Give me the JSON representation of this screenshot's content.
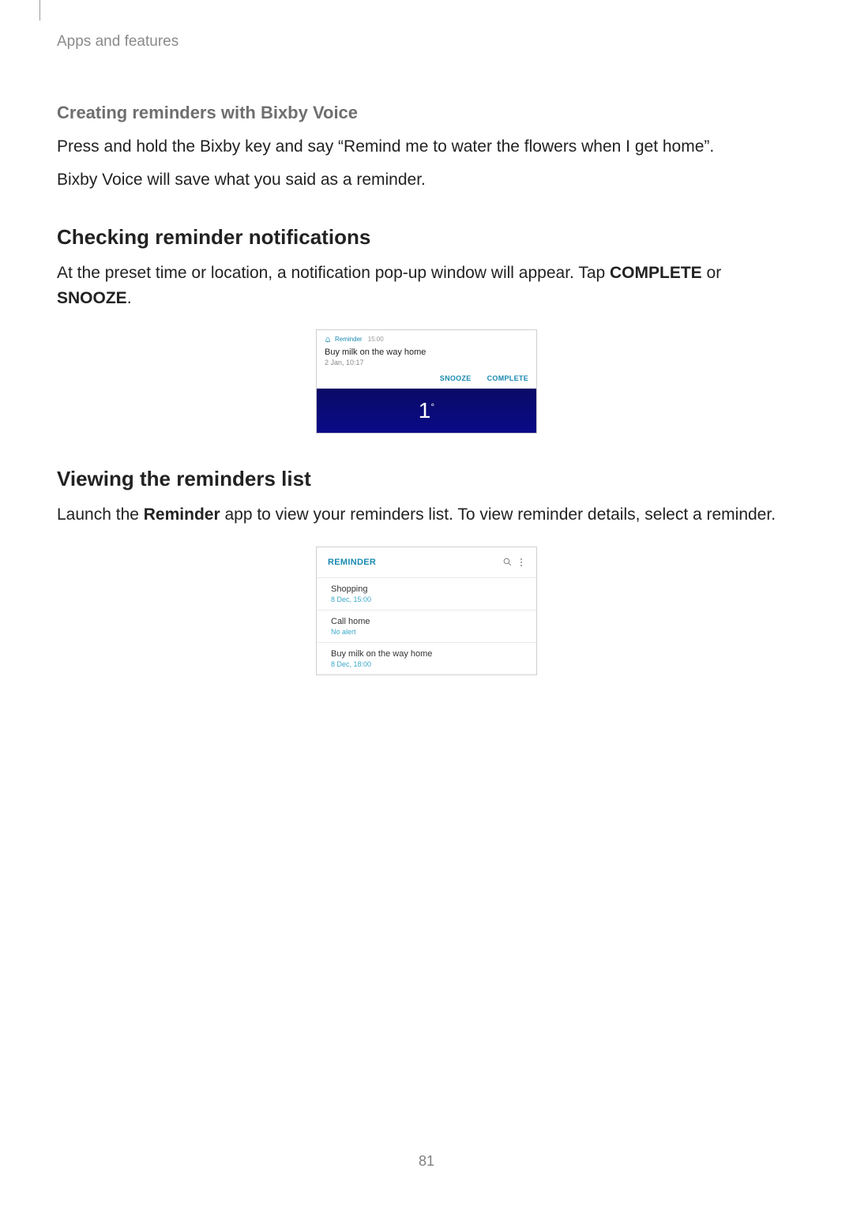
{
  "chapter": "Apps and features",
  "section1": {
    "heading": "Creating reminders with Bixby Voice",
    "p1": "Press and hold the Bixby key and say “Remind me to water the flowers when I get home”.",
    "p2": "Bixby Voice will save what you said as a reminder."
  },
  "section2": {
    "heading": "Checking reminder notifications",
    "p1_pre": "At the preset time or location, a notification pop-up window will appear. Tap ",
    "p1_b1": "COMPLETE",
    "p1_mid": " or ",
    "p1_b2": "SNOOZE",
    "p1_post": "."
  },
  "notification": {
    "app": "Reminder",
    "time": "15:00",
    "title": "Buy milk on the way home",
    "subtitle": "2 Jan, 10:17",
    "snooze": "SNOOZE",
    "complete": "COMPLETE",
    "temperature": "1",
    "degree": "°"
  },
  "section3": {
    "heading": "Viewing the reminders list",
    "p1_pre": "Launch the ",
    "p1_b1": "Reminder",
    "p1_post": " app to view your reminders list. To view reminder details, select a reminder."
  },
  "reminder_list": {
    "header": "REMINDER",
    "items": [
      {
        "title": "Shopping",
        "sub": "8 Dec, 15:00"
      },
      {
        "title": "Call home",
        "sub": "No alert"
      },
      {
        "title": "Buy milk on the way home",
        "sub": "8 Dec, 18:00"
      }
    ]
  },
  "page_number": "81"
}
